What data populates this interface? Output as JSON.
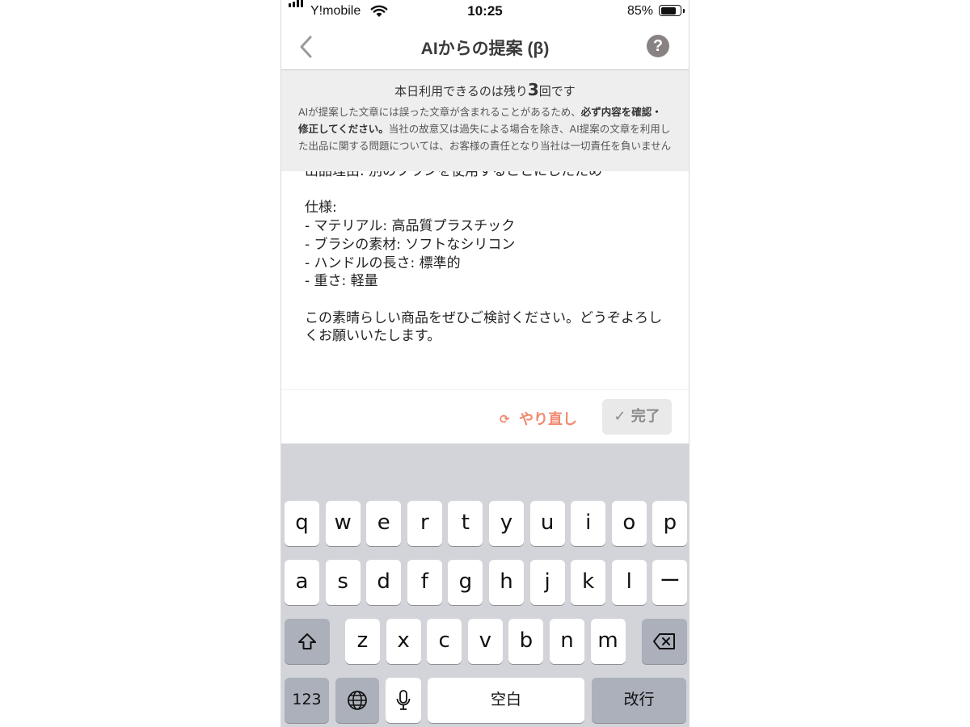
{
  "status_bar": {
    "carrier": "Y!mobile",
    "time": "10:25",
    "battery_percent": "85%",
    "battery_level": 0.85,
    "signal_bars": 4
  },
  "nav": {
    "title": "AIからの提案 (β)",
    "back_icon": "chevron-left-icon",
    "help_label": "?"
  },
  "notice": {
    "remaining_prefix": "本日利用できるのは残り",
    "remaining_count": "3",
    "remaining_suffix": "回です",
    "disclaimer_part1": "AIが提案した文章には誤った文章が含まれることがあるため、",
    "disclaimer_bold": "必ず内容を確認・修正してください。",
    "disclaimer_part2": "当社の故意又は過失による場合を除き、AI提案の文章を利用した出品に関する問題については、お客様の責任となり当社は一切責任を負いません"
  },
  "text_content": "出品理由: 別のブランを使用することにしたため\n\n仕様:\n- マテリアル: 高品質プラスチック\n- ブラシの素材: ソフトなシリコン\n- ハンドルの長さ: 標準的\n- 重さ: 軽量\n\nこの素晴らしい商品をぜひご検討ください。どうぞよろしくお願いいたします。",
  "actions": {
    "redo_label": "やり直し",
    "done_label": "完了"
  },
  "keyboard": {
    "row1": [
      "q",
      "w",
      "e",
      "r",
      "t",
      "y",
      "u",
      "i",
      "o",
      "p"
    ],
    "row2": [
      "a",
      "s",
      "d",
      "f",
      "g",
      "h",
      "j",
      "k",
      "l",
      "ー"
    ],
    "row3": [
      "z",
      "x",
      "c",
      "v",
      "b",
      "n",
      "m"
    ],
    "numbers_label": "123",
    "space_label": "空白",
    "return_label": "改行"
  }
}
